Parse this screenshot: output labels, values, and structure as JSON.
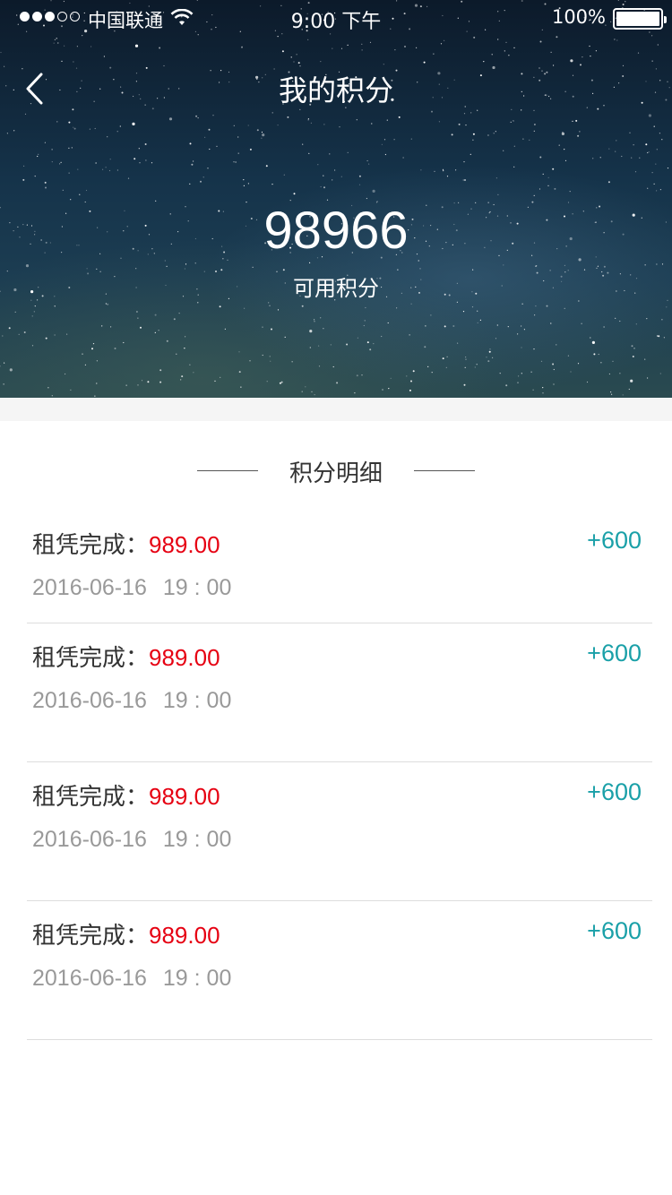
{
  "status_bar": {
    "carrier": "中国联通",
    "time": "9:00 下午",
    "battery": "100%"
  },
  "nav": {
    "title": "我的积分"
  },
  "points": {
    "value": "98966",
    "label": "可用积分"
  },
  "section": {
    "title": "积分明细"
  },
  "records": [
    {
      "name": "租凭完成：",
      "amount": "989.00",
      "points": "+600",
      "date": "2016-06-16",
      "time": "19 : 00"
    },
    {
      "name": "租凭完成：",
      "amount": "989.00",
      "points": "+600",
      "date": "2016-06-16",
      "time": "19 : 00"
    },
    {
      "name": "租凭完成：",
      "amount": "989.00",
      "points": "+600",
      "date": "2016-06-16",
      "time": "19 : 00"
    },
    {
      "name": "租凭完成：",
      "amount": "989.00",
      "points": "+600",
      "date": "2016-06-16",
      "time": "19 : 00"
    }
  ],
  "colors": {
    "amount": "#e60012",
    "points": "#1aa0a8",
    "muted": "#999999"
  },
  "icons": [
    "signal-icon",
    "wifi-icon",
    "battery-icon",
    "back-arrow-icon"
  ]
}
